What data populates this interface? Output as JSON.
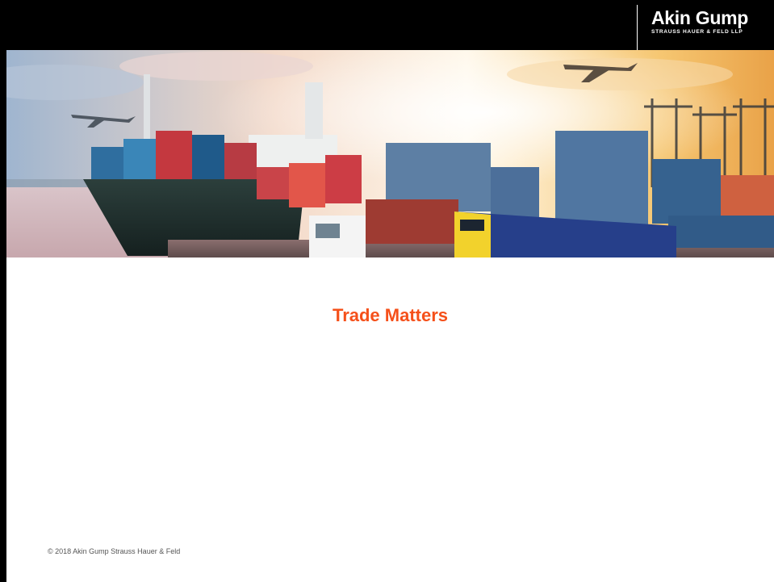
{
  "branding": {
    "logo_main": "Akin Gump",
    "logo_sub": "STRAUSS HAUER & FELD LLP"
  },
  "slide": {
    "title": "Trade Matters",
    "title_color": "#f5501a",
    "footer": "© 2018 Akin Gump Strauss Hauer & Feld"
  },
  "banner": {
    "subject": "shipping-logistics-photo"
  },
  "colors": {
    "header_bg": "#000000",
    "page_bg": "#ffffff"
  }
}
